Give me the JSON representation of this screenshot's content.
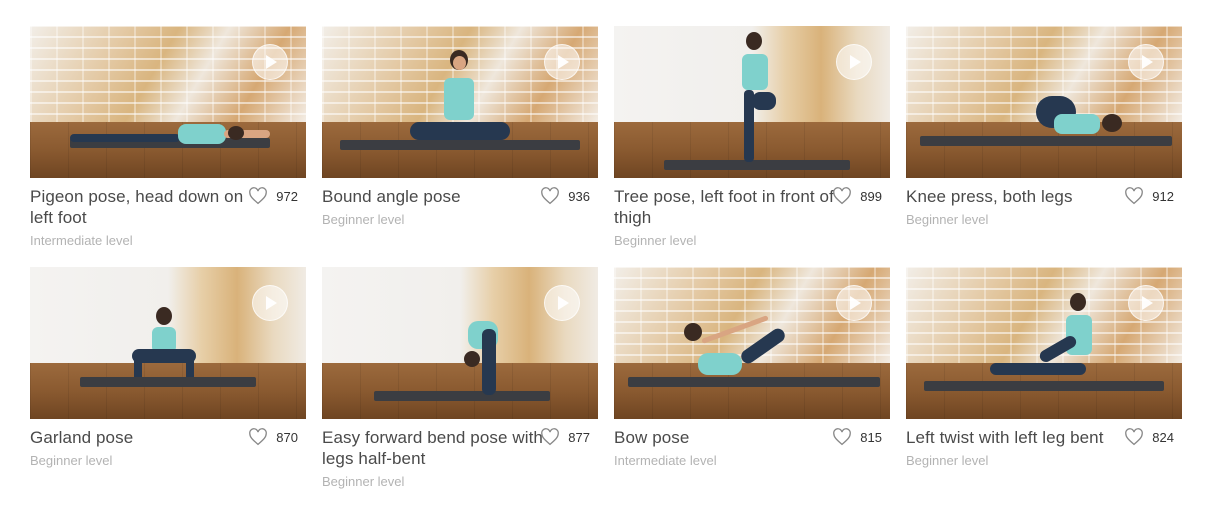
{
  "poses": [
    {
      "title": "Pigeon pose, head down on left foot",
      "level": "Intermediate level",
      "likes": "972"
    },
    {
      "title": "Bound angle pose",
      "level": "Beginner level",
      "likes": "936"
    },
    {
      "title": "Tree pose, left foot in front of thigh",
      "level": "Beginner level",
      "likes": "899"
    },
    {
      "title": "Knee press, both legs",
      "level": "Beginner level",
      "likes": "912"
    },
    {
      "title": "Garland pose",
      "level": "Beginner level",
      "likes": "870"
    },
    {
      "title": "Easy forward bend pose with legs half-bent",
      "level": "Beginner level",
      "likes": "877"
    },
    {
      "title": "Bow pose",
      "level": "Intermediate level",
      "likes": "815"
    },
    {
      "title": "Left twist with left leg bent",
      "level": "Beginner level",
      "likes": "824"
    }
  ],
  "icons": {
    "play": "play-icon",
    "like": "heart-icon"
  },
  "colors": {
    "title": "#4a4a4a",
    "level": "#b3b3b3",
    "count": "#333333"
  }
}
